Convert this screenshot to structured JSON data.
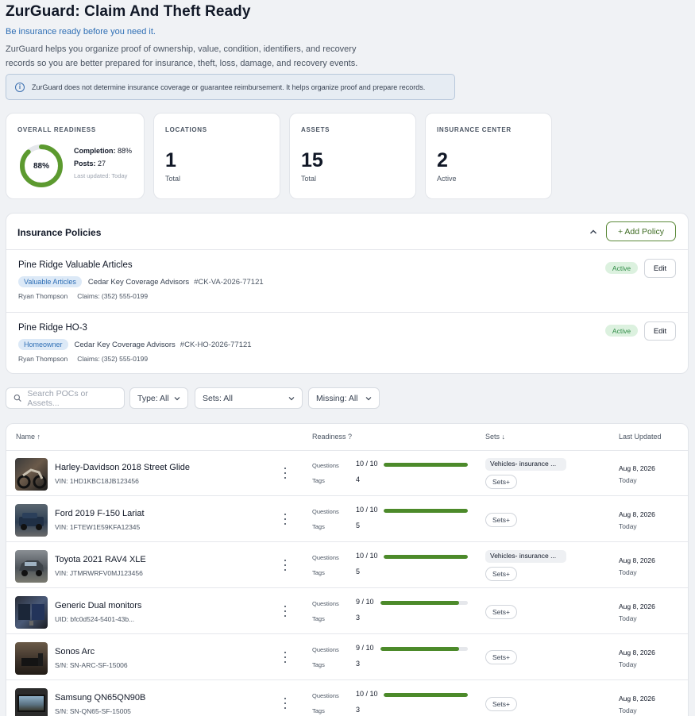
{
  "header": {
    "title": "ZurGuard: Claim And Theft Ready",
    "subtitle": "Be insurance ready before you need it.",
    "description_line1": "ZurGuard helps you organize proof of ownership, value, condition, identifiers, and recovery",
    "description_line2": "records so you are better prepared for insurance, theft, loss, damage, and recovery events.",
    "notice": "ZurGuard does not determine insurance coverage or guarantee reimbursement. It helps organize proof and prepare records."
  },
  "stats": {
    "readiness": {
      "label": "OVERALL READINESS",
      "percent_text": "88%",
      "percent_value": 88,
      "completion_label": "Completion:",
      "completion_value": "88%",
      "posts_label": "Posts:",
      "posts_value": "27",
      "last_updated": "Last updated: Today"
    },
    "locations": {
      "label": "LOCATIONS",
      "value": "1",
      "sub": "Total"
    },
    "assets": {
      "label": "ASSETS",
      "value": "15",
      "sub": "Total"
    },
    "insurance": {
      "label": "INSURANCE CENTER",
      "value": "2",
      "sub": "Active"
    }
  },
  "policies": {
    "heading": "Insurance Policies",
    "add_label": "+ Add Policy",
    "items": [
      {
        "name": "Pine Ridge Valuable Articles",
        "type": "Valuable Articles",
        "agency": "Cedar Key Coverage Advisors",
        "number": "#CK-VA-2026-77121",
        "agent": "Ryan Thompson",
        "claims": "Claims: (352) 555-0199",
        "status": "Active",
        "edit_label": "Edit"
      },
      {
        "name": "Pine Ridge HO-3",
        "type": "Homeowner",
        "agency": "Cedar Key Coverage Advisors",
        "number": "#CK-HO-2026-77121",
        "agent": "Ryan Thompson",
        "claims": "Claims: (352) 555-0199",
        "status": "Active",
        "edit_label": "Edit"
      }
    ]
  },
  "filters": {
    "search_placeholder": "Search POCs or Assets...",
    "type": "Type: All",
    "sets": "Sets: All",
    "missing": "Missing: All"
  },
  "table": {
    "columns": {
      "name": "Name ↑",
      "readiness": "Readiness ?",
      "sets": "Sets ↓",
      "updated": "Last Updated"
    },
    "questions_label": "Questions",
    "tags_label": "Tags",
    "sets_button": "Sets+",
    "rows": [
      {
        "name": "Harley-Davidson 2018 Street Glide",
        "id": "VIN: 1HD1KBC18JB123456",
        "questions": "10 / 10",
        "progress": 1.0,
        "tags": "4",
        "set": "Vehicles- insurance ...",
        "date": "Aug 8, 2026",
        "rel": "Today"
      },
      {
        "name": "Ford 2019 F-150 Lariat",
        "id": "VIN: 1FTEW1E59KFA12345",
        "questions": "10 / 10",
        "progress": 1.0,
        "tags": "5",
        "set": "",
        "date": "Aug 8, 2026",
        "rel": "Today"
      },
      {
        "name": "Toyota 2021 RAV4 XLE",
        "id": "VIN: JTMRWRFV0MJ123456",
        "questions": "10 / 10",
        "progress": 1.0,
        "tags": "5",
        "set": "Vehicles- insurance ...",
        "date": "Aug 8, 2026",
        "rel": "Today"
      },
      {
        "name": "Generic Dual monitors",
        "id": "UID: bfc0d524-5401-43b...",
        "questions": "9 / 10",
        "progress": 0.9,
        "tags": "3",
        "set": "",
        "date": "Aug 8, 2026",
        "rel": "Today"
      },
      {
        "name": "Sonos Arc",
        "id": "S/N: SN-ARC-SF-15006",
        "questions": "9 / 10",
        "progress": 0.9,
        "tags": "3",
        "set": "",
        "date": "Aug 8, 2026",
        "rel": "Today"
      },
      {
        "name": "Samsung QN65QN90B",
        "id": "S/N: SN-QN65-SF-15005",
        "questions": "10 / 10",
        "progress": 1.0,
        "tags": "3",
        "set": "",
        "date": "Aug 8, 2026",
        "rel": "Today"
      }
    ]
  },
  "colors": {
    "accent_green": "#4c8a2a",
    "link_blue": "#2f6fb5"
  }
}
